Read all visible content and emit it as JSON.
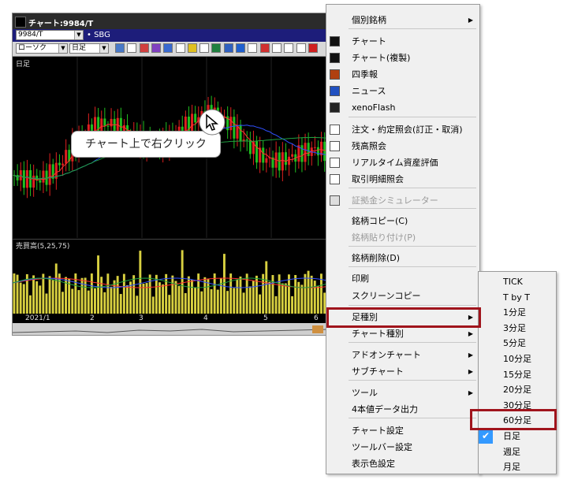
{
  "window": {
    "title": "チャート:9984/T",
    "symbol_code": "9984/T",
    "symbol_name": "• SBG",
    "chart_type": "ローソク",
    "period": "日足",
    "plot_label": "日足",
    "volume_label": "売買高(5,25,75)",
    "x_ticks": [
      "2021/1",
      "2",
      "3",
      "4",
      "5",
      "6"
    ]
  },
  "callout": "チャート上で右クリック",
  "menu": {
    "items": [
      {
        "label": "個別銘柄",
        "submenu": true
      },
      {
        "label": "チャート",
        "icon": "chart-icon"
      },
      {
        "label": "チャート(複製)",
        "icon": "chart-duplicate-icon"
      },
      {
        "label": "四季報",
        "icon": "shikiho-icon"
      },
      {
        "label": "ニュース",
        "icon": "news-icon"
      },
      {
        "label": "xenoFlash",
        "icon": "flash-icon"
      },
      {
        "label": "注文・約定照会(訂正・取消)",
        "icon": "order-icon"
      },
      {
        "label": "残高照会",
        "icon": "balance-icon"
      },
      {
        "label": "リアルタイム資産評価",
        "icon": "asset-icon"
      },
      {
        "label": "取引明細照会",
        "icon": "transaction-icon"
      },
      {
        "label": "証拠金シミュレーター",
        "icon": "calculator-icon",
        "disabled": true
      },
      {
        "label": "銘柄コピー(C)"
      },
      {
        "label": "銘柄貼り付け(P)",
        "disabled": true
      },
      {
        "label": "銘柄削除(D)"
      },
      {
        "label": "印刷"
      },
      {
        "label": "スクリーンコピー"
      },
      {
        "label": "足種別",
        "submenu": true
      },
      {
        "label": "チャート種別",
        "submenu": true
      },
      {
        "label": "アドオンチャート",
        "submenu": true
      },
      {
        "label": "サブチャート",
        "submenu": true
      },
      {
        "label": "ツール",
        "submenu": true
      },
      {
        "label": "4本値データ出力"
      },
      {
        "label": "チャート設定"
      },
      {
        "label": "ツールバー設定"
      },
      {
        "label": "表示色設定"
      }
    ]
  },
  "submenu": {
    "items": [
      {
        "label": "TICK"
      },
      {
        "label": "T by T"
      },
      {
        "label": "1分足"
      },
      {
        "label": "3分足"
      },
      {
        "label": "5分足"
      },
      {
        "label": "10分足"
      },
      {
        "label": "15分足"
      },
      {
        "label": "20分足"
      },
      {
        "label": "30分足"
      },
      {
        "label": "60分足",
        "highlighted": true
      },
      {
        "label": "日足",
        "checked": true
      },
      {
        "label": "週足"
      },
      {
        "label": "月足"
      }
    ]
  },
  "colors": {
    "highlight_border": "#a0141c",
    "candle_up": "#e02020",
    "candle_down": "#20c020",
    "volume_bar": "#d8d040",
    "check_bg": "#3399ff"
  }
}
